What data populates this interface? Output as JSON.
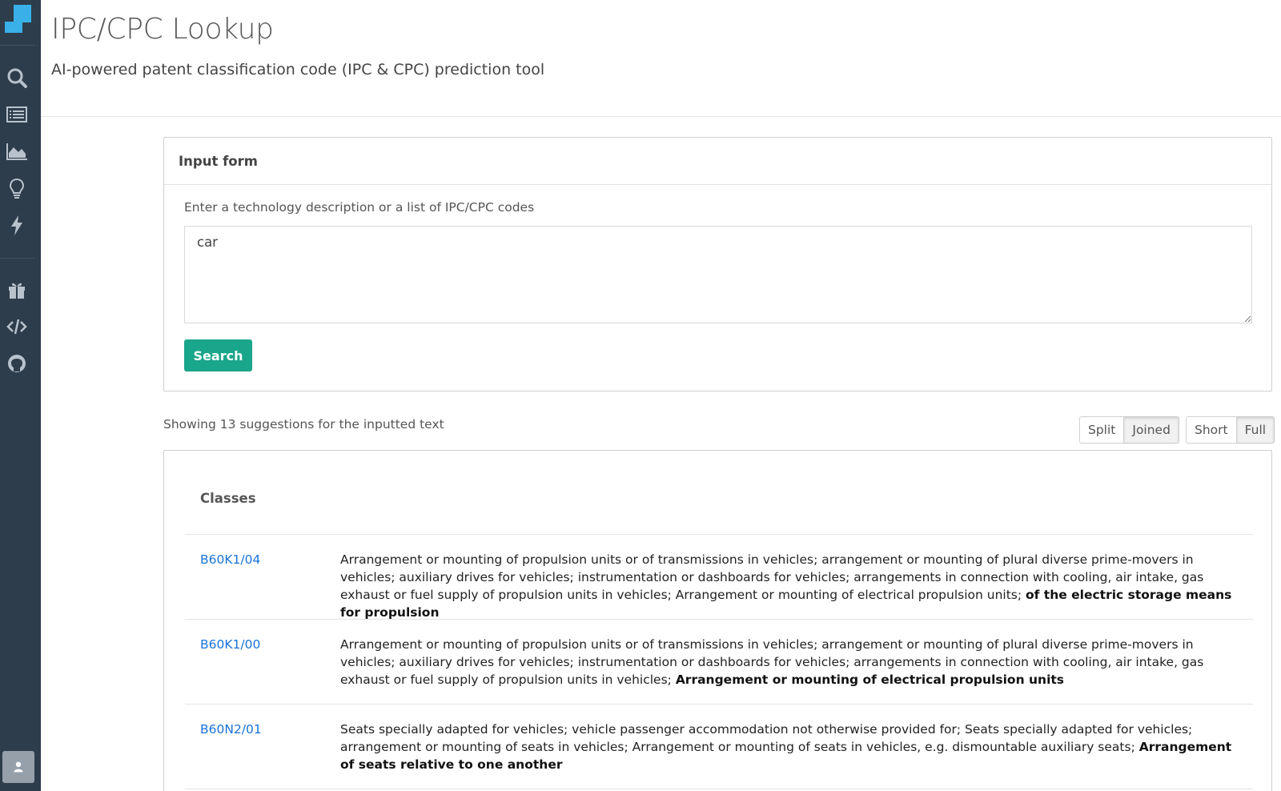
{
  "sidebar": {
    "logo": "app-logo",
    "icons": [
      "search-icon",
      "list-icon",
      "area-chart-icon",
      "lightbulb-icon",
      "lightning-icon",
      "gift-icon",
      "code-icon",
      "github-icon"
    ],
    "user_icon": "user-icon",
    "bg_color": "#2e3d4b",
    "logo_color": "#3ab0e8"
  },
  "header": {
    "title": "IPC/CPC Lookup",
    "subtitle": "AI-powered patent classification code (IPC & CPC) prediction tool"
  },
  "input_form": {
    "heading": "Input form",
    "label": "Enter a technology description or a list of IPC/CPC codes",
    "value": "car",
    "search_label": "Search"
  },
  "results": {
    "info": "Showing 13 suggestions for the inputted text",
    "view_toggle": [
      {
        "label": "Split",
        "active": false
      },
      {
        "label": "Joined",
        "active": true
      }
    ],
    "length_toggle": [
      {
        "label": "Short",
        "active": false
      },
      {
        "label": "Full",
        "active": true
      }
    ],
    "classes_heading": "Classes",
    "rows": [
      {
        "code": "B60K1/04",
        "desc_plain": "Arrangement or mounting of propulsion units or of transmissions in vehicles; arrangement or mounting of plural diverse prime-movers in vehicles; auxiliary drives for vehicles; instrumentation or dashboards for vehicles; arrangements in connection with cooling, air intake, gas exhaust or fuel supply of propulsion units in vehicles; Arrangement or mounting of electrical propulsion units; ",
        "desc_bold": "of the electric storage means for propulsion"
      },
      {
        "code": "B60K1/00",
        "desc_plain": "Arrangement or mounting of propulsion units or of transmissions in vehicles; arrangement or mounting of plural diverse prime-movers in vehicles; auxiliary drives for vehicles; instrumentation or dashboards for vehicles; arrangements in connection with cooling, air intake, gas exhaust or fuel supply of propulsion units in vehicles; ",
        "desc_bold": "Arrangement or mounting of electrical propulsion units"
      },
      {
        "code": "B60N2/01",
        "desc_plain": "Seats specially adapted for vehicles; vehicle passenger accommodation not otherwise provided for; Seats specially adapted for vehicles; arrangement or mounting of seats in vehicles; Arrangement or mounting of seats in vehicles, e.g. dismountable auxiliary seats; ",
        "desc_bold": "Arrangement of seats relative to one another"
      }
    ]
  },
  "colors": {
    "accent_button": "#1aa68a",
    "link": "#1a73d6"
  }
}
